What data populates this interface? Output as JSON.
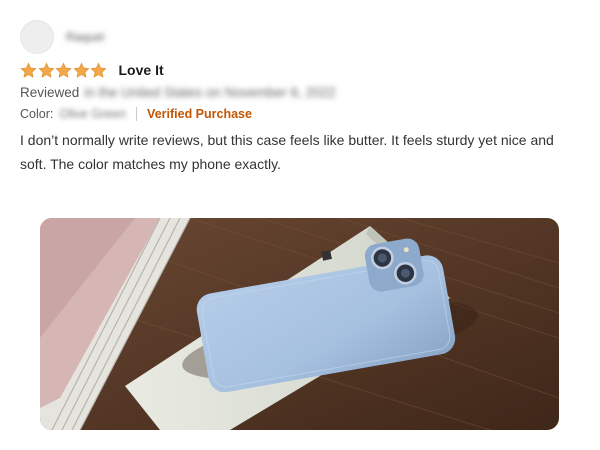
{
  "review": {
    "author": "Raquel",
    "rating": 5,
    "rating_max": 5,
    "title": "Love It",
    "reviewed_label": "Reviewed",
    "reviewed_detail": "in the United States on November 6, 2022",
    "variant_label": "Color:",
    "variant_value": "Olive Green",
    "verified_label": "Verified Purchase",
    "body": "I don’t normally write reviews, but this case feels like butter. It feels sturdy yet nice and soft. The color matches my phone exactly."
  },
  "colors": {
    "star": "#f3a847",
    "verified": "#c45500",
    "case": "#a9c3e2",
    "table": "#5a3b28"
  },
  "icons": {
    "star": "star-icon",
    "avatar": "user-avatar"
  }
}
